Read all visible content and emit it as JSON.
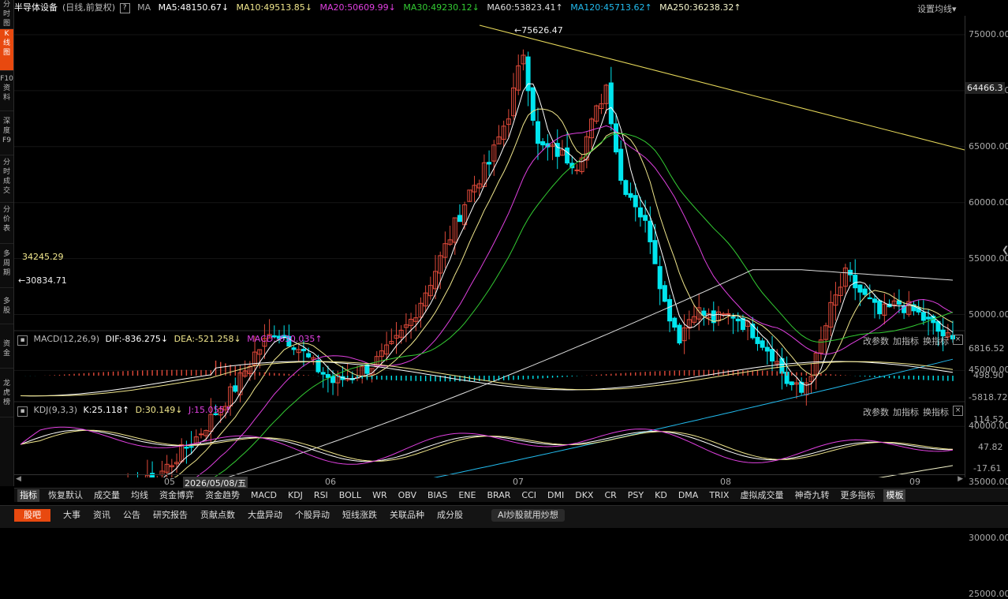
{
  "sidebar": {
    "items": [
      {
        "label": "分时\n图",
        "active": false
      },
      {
        "label": "K\n线\n图",
        "active": true
      },
      {
        "label": "F10\n资\n料",
        "active": false
      },
      {
        "label": "深\n度\nF9",
        "active": false
      },
      {
        "label": "分\n时\n成\n交",
        "active": false
      },
      {
        "label": "分\n价\n表",
        "active": false
      },
      {
        "label": "多\n周\n期",
        "active": false
      },
      {
        "label": "多\n股",
        "active": false
      },
      {
        "label": "资\n金",
        "active": false
      },
      {
        "label": "龙\n虎\n榜",
        "active": false
      }
    ]
  },
  "header": {
    "title": "半导体设备",
    "period": "(日线,前复权)",
    "help": "?",
    "ma_label": "MA",
    "ma5": "MA5:48150.67↓",
    "ma10": "MA10:49513.85↓",
    "ma20": "MA20:50609.99↓",
    "ma30": "MA30:49230.12↓",
    "ma60": "MA60:53823.41↑",
    "ma120": "MA120:45713.62↑",
    "ma250": "MA250:36238.32↑",
    "settings": "设置均线▾"
  },
  "colors": {
    "ma5": "#ffffff",
    "ma10": "#f0e68c",
    "ma20": "#e040e0",
    "ma30": "#33cc33",
    "ma60": "#dddddd",
    "ma120": "#22bbee",
    "ma250": "#f5f5cc",
    "up": "#e04a3a",
    "down": "#00e5ee",
    "trend": "#e6d85a"
  },
  "price_axis": {
    "ticks": [
      "75000.00",
      "70000.00",
      "65000.00",
      "60000.00",
      "55000.00",
      "50000.00",
      "45000.00",
      "40000.00",
      "35000.00",
      "30000.00",
      "25000.00"
    ],
    "current": "64466.3"
  },
  "annotations": {
    "high": "←75626.47",
    "low": "←30834.71",
    "hline": "34245.29"
  },
  "macd": {
    "name": "MACD(12,26,9)",
    "dif": "DIF:-836.275↓",
    "dea": "DEA:-521.258↓",
    "macd": "MACD:-630.035↑",
    "ticks": [
      "6816.52",
      "498.90",
      "-5818.72"
    ]
  },
  "kdj": {
    "name": "KDJ(9,3,3)",
    "k": "K:25.118↑",
    "d": "D:30.149↓",
    "j": "J:15.055↑",
    "ticks": [
      "114.52",
      "47.82",
      "-17.61"
    ]
  },
  "panel_controls": {
    "params": "改参数",
    "add": "加指标",
    "switch": "换指标",
    "close": "×"
  },
  "x_axis": {
    "ticks": [
      "05",
      "2026/05/08/五",
      "06",
      "07",
      "08",
      "09"
    ]
  },
  "indicator_tabs": [
    "指标",
    "恢复默认",
    "成交量",
    "均线",
    "资金博弈",
    "资金趋势",
    "MACD",
    "KDJ",
    "RSI",
    "BOLL",
    "WR",
    "OBV",
    "BIAS",
    "ENE",
    "BRAR",
    "CCI",
    "DMI",
    "DKX",
    "CR",
    "PSY",
    "KD",
    "DMA",
    "TRIX",
    "虚拟成交量",
    "神奇九转",
    "更多指标",
    "模板"
  ],
  "bottom_tabs": [
    "股吧",
    "大事",
    "资讯",
    "公告",
    "研究报告",
    "贡献点数",
    "大盘异动",
    "个股异动",
    "短线涨跌",
    "关联品种",
    "成分股"
  ],
  "ai_button": "AI炒股就用炒想"
}
